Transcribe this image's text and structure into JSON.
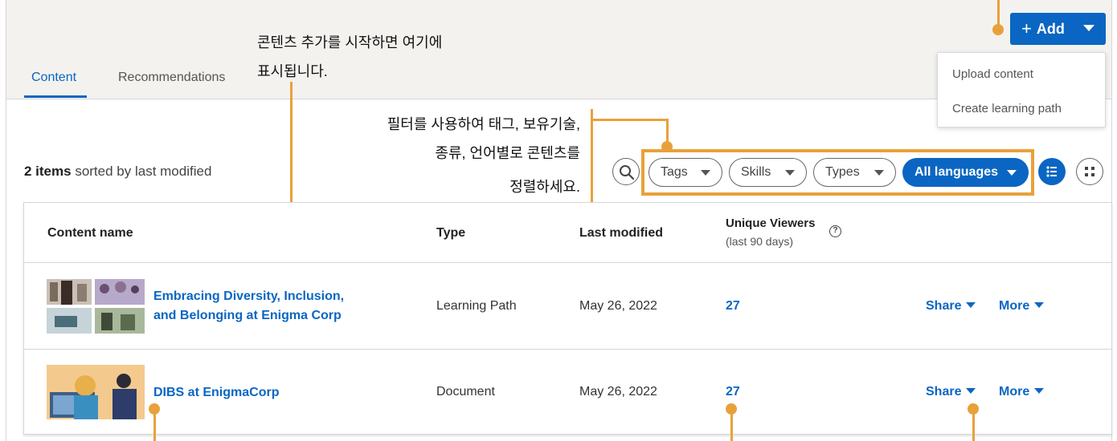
{
  "tabs": [
    {
      "label": "Content",
      "active": true
    },
    {
      "label": "Recommendations",
      "active": false
    }
  ],
  "add_button": {
    "label": "Add",
    "icon": "plus-icon"
  },
  "add_menu": {
    "items": [
      "Upload content",
      "Create learning path"
    ]
  },
  "callouts": {
    "content_added": [
      "콘텐츠 추가를 시작하면 여기에",
      "표시됩니다."
    ],
    "filters": [
      "필터를 사용하여 태그, 보유기술,",
      "종류, 언어별로 콘텐츠를",
      "정렬하세요."
    ]
  },
  "summary": {
    "count": "2 items",
    "suffix": " sorted by last modified"
  },
  "filters": {
    "tags": "Tags",
    "skills": "Skills",
    "types": "Types",
    "languages": "All languages"
  },
  "table": {
    "headers": {
      "name": "Content name",
      "type": "Type",
      "modified": "Last modified",
      "viewers": "Unique Viewers",
      "viewers_sub": "(last 90 days)"
    },
    "rows": [
      {
        "title_line1": "Embracing Diversity, Inclusion,",
        "title_line2": "and Belonging at Enigma Corp",
        "type": "Learning Path",
        "modified": "May 26, 2022",
        "viewers": "27",
        "share": "Share",
        "more": "More"
      },
      {
        "title_line1": "DIBS at EnigmaCorp",
        "title_line2": "",
        "type": "Document",
        "modified": "May 26, 2022",
        "viewers": "27",
        "share": "Share",
        "more": "More"
      }
    ]
  },
  "colors": {
    "accent": "#0a66c2",
    "annotation": "#e8a13a",
    "header_bg": "#f3f2ef"
  }
}
